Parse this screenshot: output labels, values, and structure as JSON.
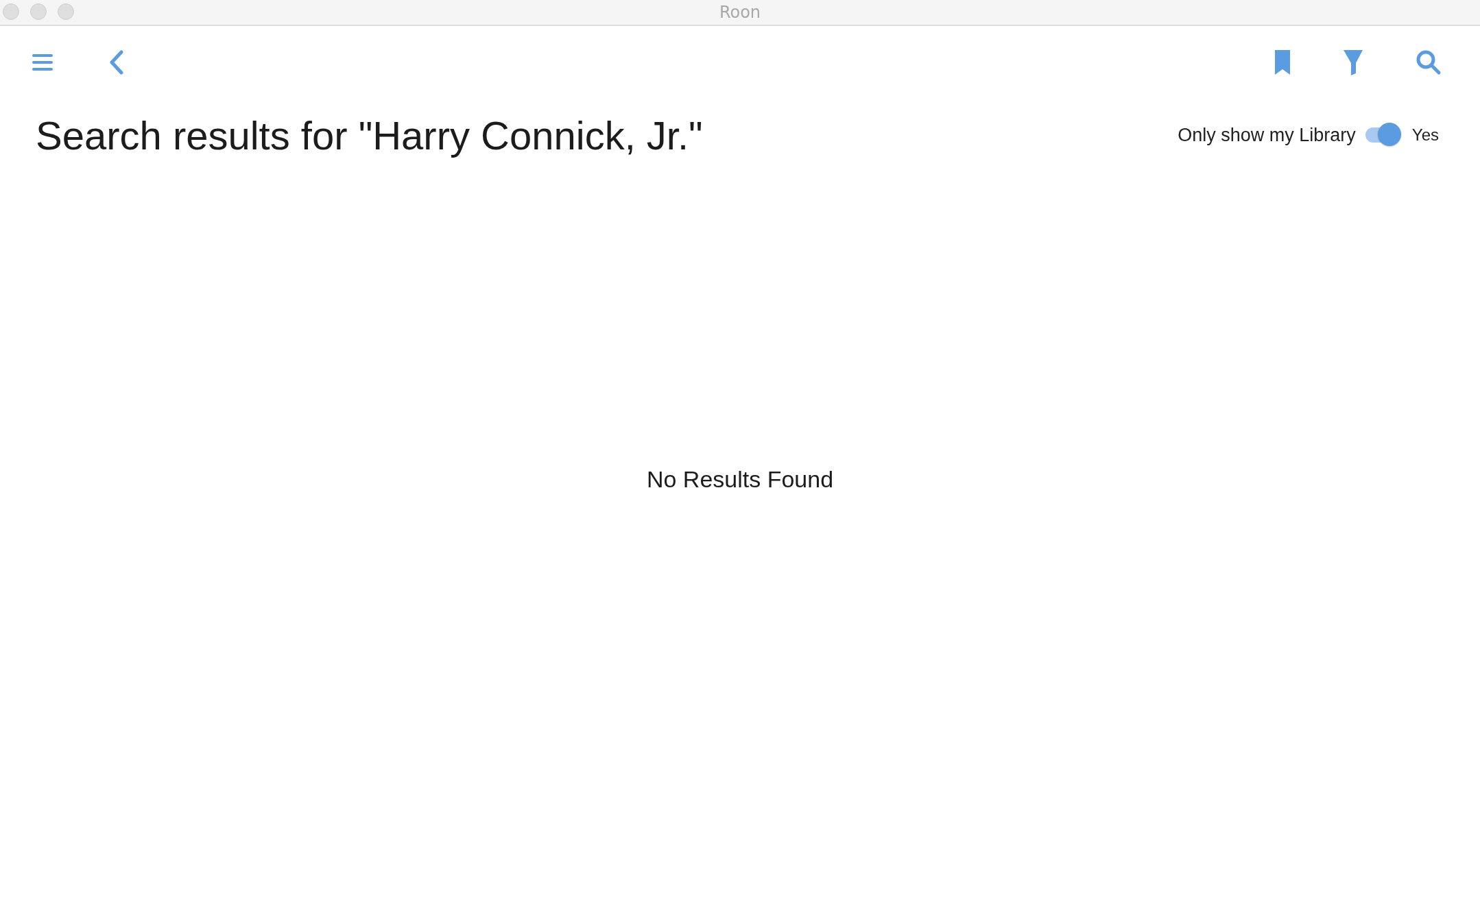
{
  "window": {
    "title": "Roon"
  },
  "heading": "Search results for \"Harry Connick, Jr.\"",
  "library_filter": {
    "label": "Only show my Library",
    "on": true,
    "value": "Yes"
  },
  "empty_message": "No Results Found"
}
